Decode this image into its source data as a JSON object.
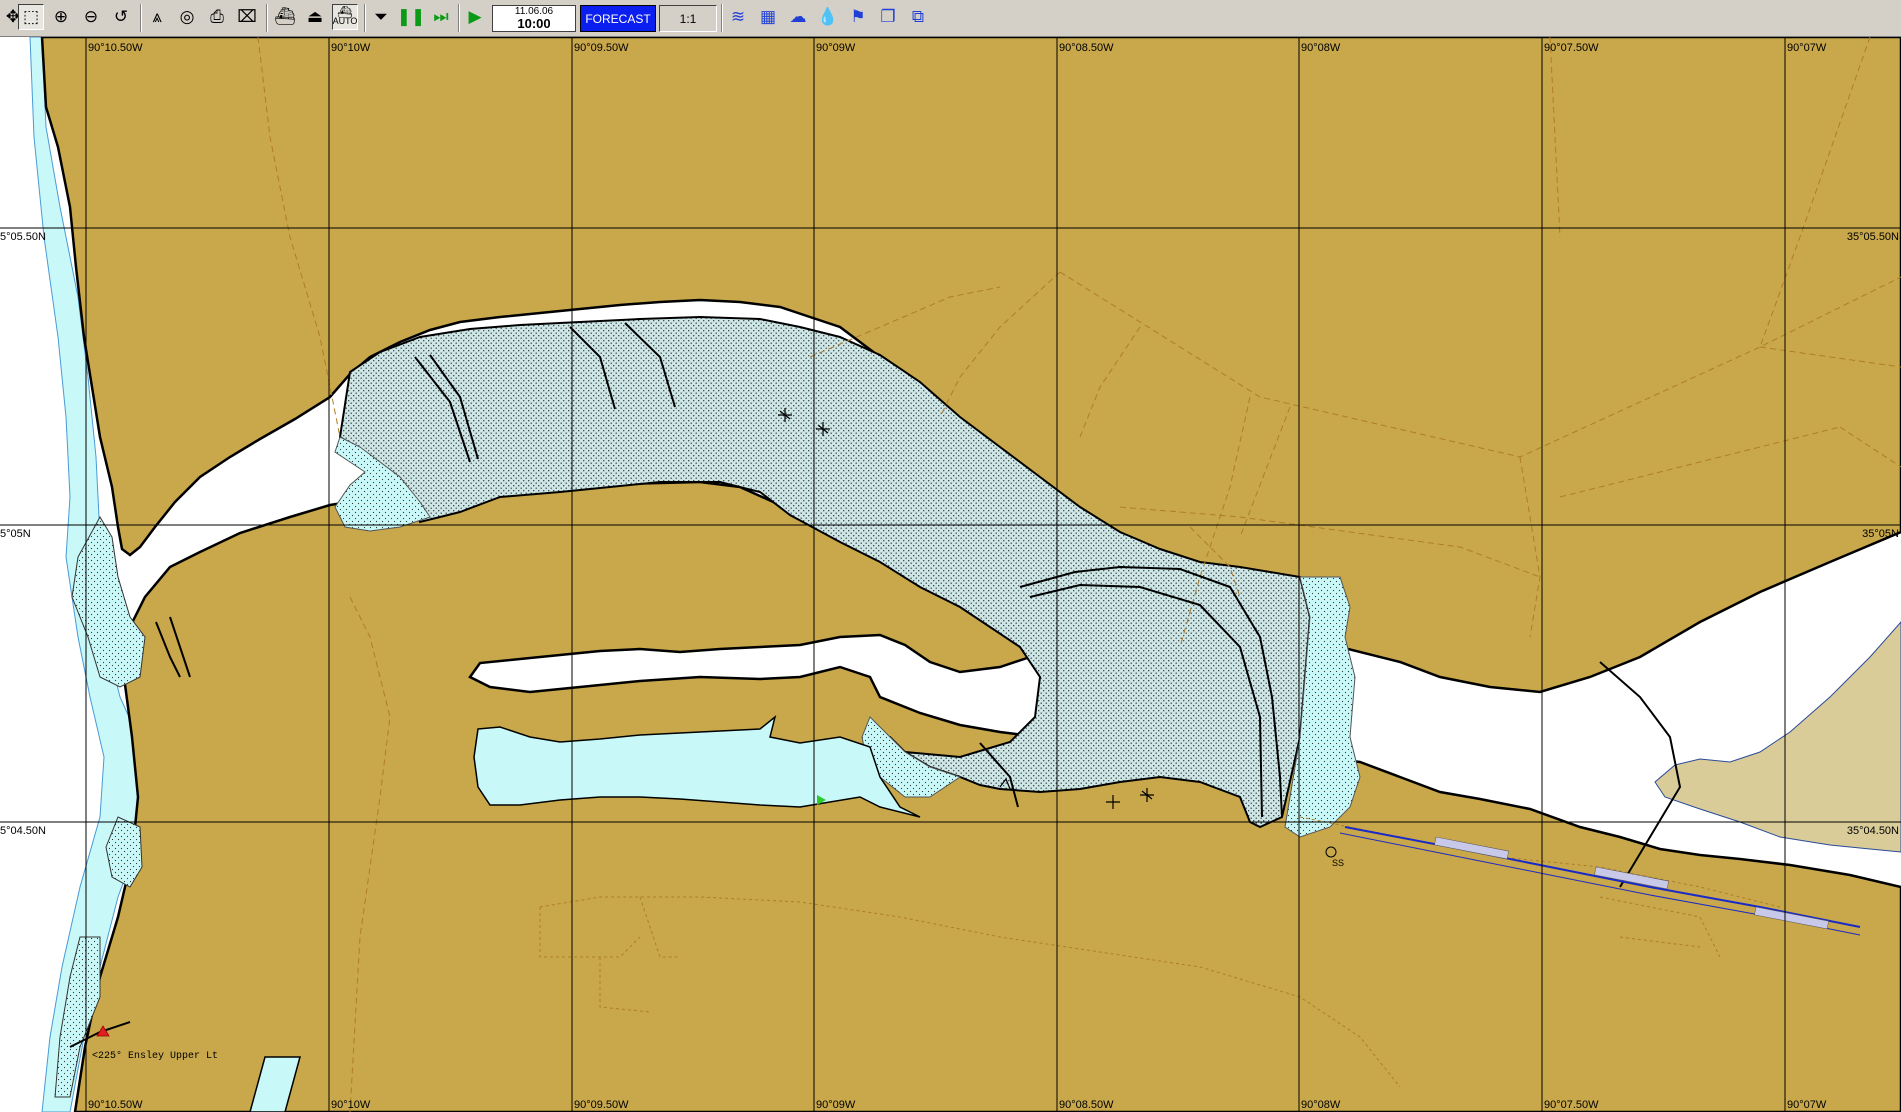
{
  "toolbar": {
    "tools": [
      {
        "name": "pan-tool",
        "icon": "pan-icon"
      },
      {
        "name": "select-tool",
        "icon": "pointer-icon"
      },
      {
        "name": "zoom-in-tool",
        "icon": "zoom-in-icon"
      },
      {
        "name": "zoom-out-tool",
        "icon": "zoom-out-icon"
      },
      {
        "name": "undo-zoom-tool",
        "icon": "undo-icon"
      },
      {
        "name": "route-tool",
        "icon": "compass-icon"
      },
      {
        "name": "target-tool",
        "icon": "target-icon"
      },
      {
        "name": "export-tool",
        "icon": "export-icon"
      },
      {
        "name": "erase-tool",
        "icon": "erase-icon"
      },
      {
        "name": "ship-tool",
        "icon": "ship-icon"
      },
      {
        "name": "ship-small-tool",
        "icon": "ship-small-icon"
      },
      {
        "name": "auto-tool",
        "icon": "auto-ship-icon"
      },
      {
        "name": "stop-tool",
        "icon": "stop-icon"
      },
      {
        "name": "pause-tool",
        "icon": "pause-icon"
      },
      {
        "name": "fast-forward-tool",
        "icon": "fast-forward-icon"
      },
      {
        "name": "play-tool",
        "icon": "play-icon"
      }
    ],
    "auto_label": "AUTO",
    "date": "11.06.06",
    "time": "10:00",
    "forecast_label": "FORECAST",
    "scale": "1:1",
    "right_tools": [
      "current-icon",
      "grid-icon",
      "weather-icon",
      "tide-icon",
      "wind-icon",
      "layers-icon",
      "window-icon"
    ]
  },
  "chart": {
    "colors": {
      "land": "#c8a84b",
      "water": "#c8f8f8",
      "shoal": "#c9e1e1",
      "sand": "#d9cc99",
      "grid": "#000000",
      "contour": "#b07c2a"
    },
    "lon_labels": [
      "90°10.50W",
      "90°10W",
      "90°09.50W",
      "90°09W",
      "90°08.50W",
      "90°08W",
      "90°07.50W",
      "90°07W"
    ],
    "lat_labels_left": [
      "5°05.50N",
      "5°05N",
      "5°04.50N"
    ],
    "lat_labels_right": [
      "35°05.50N",
      "35°05N",
      "35°04.50N"
    ],
    "feature_labels": {
      "beacon": "SS",
      "light": "<225° Ensley Upper Lt"
    }
  }
}
